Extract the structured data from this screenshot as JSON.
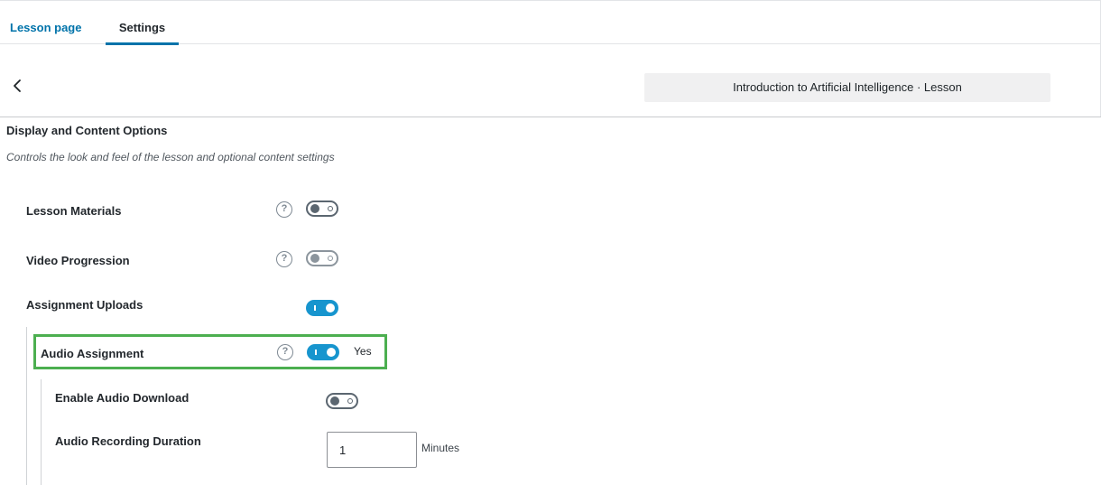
{
  "tabs": [
    {
      "label": "Lesson page",
      "active": false
    },
    {
      "label": "Settings",
      "active": true
    }
  ],
  "breadcrumb": "Introduction to Artificial Intelligence · Lesson",
  "section": {
    "title": "Display and Content Options",
    "description": "Controls the look and feel of the lesson and optional content settings"
  },
  "settings": {
    "lesson_materials": {
      "label": "Lesson Materials",
      "enabled": false
    },
    "video_progression": {
      "label": "Video Progression",
      "enabled": false
    },
    "assignment_uploads": {
      "label": "Assignment Uploads",
      "enabled": true
    },
    "audio_assignment": {
      "label": "Audio Assignment",
      "enabled": true,
      "state_text": "Yes"
    },
    "enable_audio_download": {
      "label": "Enable Audio Download",
      "enabled": false
    },
    "audio_recording_duration": {
      "label": "Audio Recording Duration",
      "value": "1",
      "unit": "Minutes"
    }
  },
  "icons": {
    "back": "chevron-left-icon",
    "help": "question-circle-icon"
  },
  "colors": {
    "accent": "#0073aa",
    "toggle_on": "#1795ce",
    "highlight": "#4caf50"
  },
  "help_glyph": "?"
}
